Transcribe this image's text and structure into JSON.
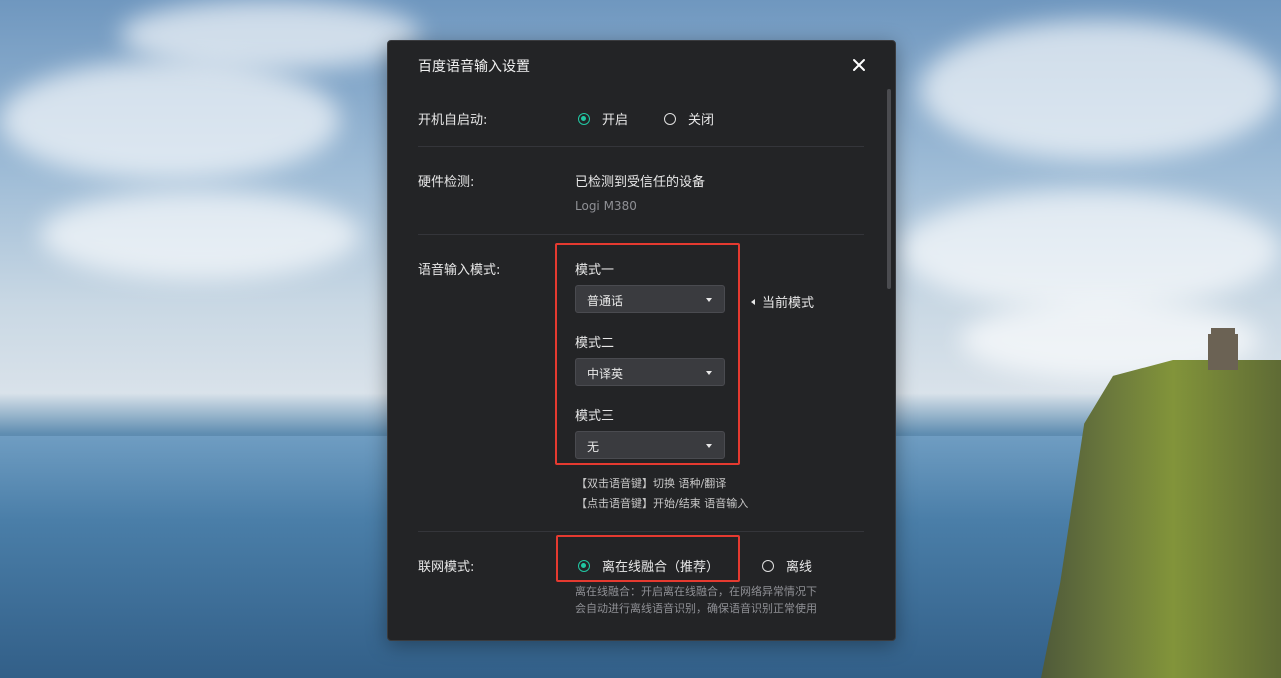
{
  "dialog": {
    "title": "百度语音输入设置"
  },
  "autostart": {
    "label": "开机自启动:",
    "options": [
      {
        "label": "开启",
        "selected": true
      },
      {
        "label": "关闭",
        "selected": false
      }
    ]
  },
  "hardware": {
    "label": "硬件检测:",
    "status": "已检测到受信任的设备",
    "device": "Logi M380"
  },
  "voice_mode": {
    "label": "语音输入模式:",
    "modes": [
      {
        "title": "模式一",
        "value": "普通话"
      },
      {
        "title": "模式二",
        "value": "中译英"
      },
      {
        "title": "模式三",
        "value": "无"
      }
    ],
    "current_indicator": "当前模式",
    "hints": [
      "【双击语音键】切换 语种/翻译",
      "【点击语音键】开始/结束 语音输入"
    ]
  },
  "network": {
    "label": "联网模式:",
    "options": [
      {
        "label": "离在线融合（推荐）",
        "selected": true
      },
      {
        "label": "离线",
        "selected": false
      }
    ],
    "description": "离在线融合：开启离在线融合，在网络异常情况下会自动进行离线语音识别，确保语音识别正常使用"
  },
  "colors": {
    "accent": "#21c7a3",
    "highlight_box": "#e53a30",
    "dialog_bg": "#232426"
  }
}
